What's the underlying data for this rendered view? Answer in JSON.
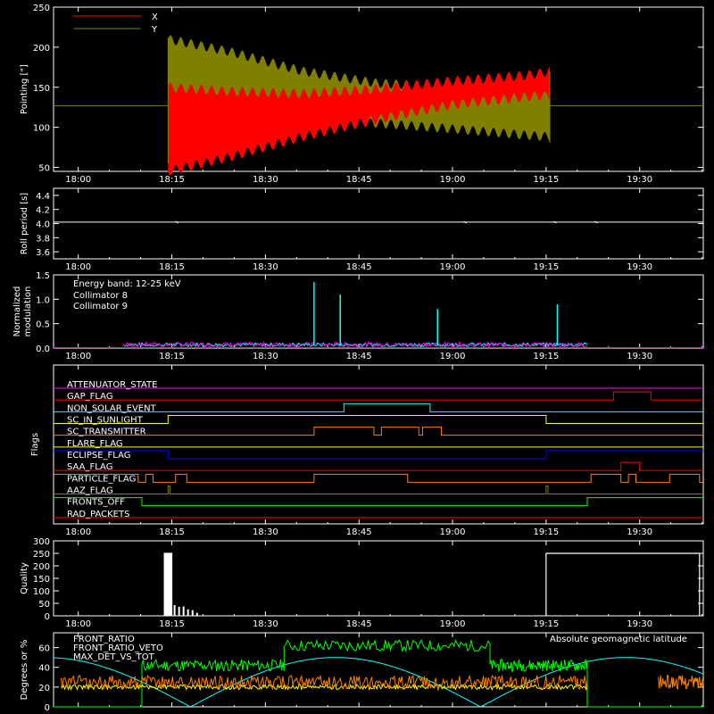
{
  "chart_data": [
    {
      "type": "area",
      "panel": "pointing",
      "ylabel": "Pointing [\"]",
      "yticks": [
        50,
        100,
        150,
        200,
        250
      ],
      "ylim": [
        45,
        250
      ],
      "xticks": [
        "18:00",
        "18:15",
        "18:30",
        "18:45",
        "19:00",
        "19:15",
        "19:30"
      ],
      "legend": [
        {
          "name": "X",
          "color": "#ff0000"
        },
        {
          "name": "Y",
          "color": "#808000"
        }
      ],
      "baseline": 127,
      "series": [
        {
          "name": "X",
          "color": "#ff0000",
          "t_min": [
            18.24,
            18.4,
            18.6,
            18.8,
            19.0,
            19.2,
            19.26
          ],
          "low": [
            45,
            62,
            88,
            110,
            128,
            138,
            140
          ],
          "high": [
            150,
            145,
            142,
            148,
            158,
            165,
            170
          ]
        },
        {
          "name": "Y",
          "color": "#808000",
          "t_min": [
            18.24,
            18.4,
            18.6,
            18.8,
            19.0,
            19.2,
            19.26
          ],
          "low": [
            95,
            105,
            110,
            105,
            98,
            90,
            88
          ],
          "high": [
            210,
            195,
            170,
            155,
            150,
            150,
            150
          ]
        }
      ]
    },
    {
      "type": "line",
      "panel": "roll",
      "ylabel": "Roll period [s]",
      "yticks": [
        "3.6",
        "3.8",
        "4.0",
        "4.2",
        "4.4"
      ],
      "ylim": [
        3.5,
        4.5
      ],
      "xticks": [
        "18:00",
        "18:15",
        "18:30",
        "18:45",
        "19:00",
        "19:15",
        "19:30"
      ],
      "series": [
        {
          "name": "",
          "color": "#ffffff",
          "value": 4.02
        }
      ]
    },
    {
      "type": "line",
      "panel": "modulation",
      "ylabel": "Normalized modulation",
      "yticks": [
        "0.0",
        "0.5",
        "1.0",
        "1.5"
      ],
      "ylim": [
        0,
        1.5
      ],
      "xticks": [
        "18:00",
        "18:15",
        "18:30",
        "18:45",
        "19:00",
        "19:15",
        "19:30"
      ],
      "legend_title": "Energy band: 12-25 keV",
      "legend": [
        {
          "name": "Collimator 8",
          "color": "#00ffff"
        },
        {
          "name": "Collimator 9",
          "color": "#ff00ff"
        }
      ],
      "spikes_c8": [
        {
          "t": 18.63,
          "v": 1.35
        },
        {
          "t": 18.7,
          "v": 1.1
        },
        {
          "t": 18.96,
          "v": 0.8
        },
        {
          "t": 19.28,
          "v": 0.9
        }
      ],
      "range": [
        18.12,
        19.36
      ],
      "baseline_value": 0.07
    },
    {
      "type": "table",
      "panel": "flags",
      "ylabel": "Flags",
      "xticks": [
        "18:00",
        "18:15",
        "18:30",
        "18:45",
        "19:00",
        "19:15",
        "19:30"
      ],
      "flags": [
        {
          "name": "ATTENUATOR_STATE",
          "color": "#ff00ff",
          "steps": [
            [
              18.0,
              0
            ],
            [
              19.67,
              0
            ]
          ]
        },
        {
          "name": "GAP_FLAG",
          "color": "#ff0000",
          "steps": [
            [
              18.0,
              0
            ],
            [
              19.43,
              1
            ],
            [
              19.53,
              0
            ],
            [
              19.67,
              0
            ]
          ]
        },
        {
          "name": "NON_SOLAR_EVENT",
          "color": "#00ffff",
          "steps": [
            [
              18.0,
              0
            ],
            [
              18.71,
              1
            ],
            [
              18.94,
              0
            ],
            [
              19.67,
              0
            ]
          ]
        },
        {
          "name": "SC_IN_SUNLIGHT",
          "color": "#ffff00",
          "steps": [
            [
              18.0,
              0
            ],
            [
              18.24,
              1
            ],
            [
              19.25,
              0
            ],
            [
              19.67,
              0
            ]
          ]
        },
        {
          "name": "SC_TRANSMITTER",
          "color": "#ff8000",
          "steps": [
            [
              18.0,
              0
            ],
            [
              18.63,
              1
            ],
            [
              18.79,
              0
            ],
            [
              18.81,
              1
            ],
            [
              18.91,
              0
            ],
            [
              18.92,
              1
            ],
            [
              18.97,
              0
            ],
            [
              19.67,
              0
            ]
          ]
        },
        {
          "name": "FLARE_FLAG",
          "color": "#ffff00",
          "steps": [
            [
              18.0,
              0
            ],
            [
              19.67,
              0
            ]
          ]
        },
        {
          "name": "ECLIPSE_FLAG",
          "color": "#0000ff",
          "steps": [
            [
              18.0,
              1
            ],
            [
              18.24,
              0
            ],
            [
              19.25,
              1
            ],
            [
              19.67,
              1
            ]
          ]
        },
        {
          "name": "SAA_FLAG",
          "color": "#ff0000",
          "steps": [
            [
              18.0,
              0
            ],
            [
              19.45,
              1
            ],
            [
              19.5,
              0
            ],
            [
              19.67,
              0
            ]
          ]
        },
        {
          "name": "PARTICLE_FLAG",
          "color": "#ff8000",
          "steps": [
            [
              18.0,
              1
            ],
            [
              18.16,
              0
            ],
            [
              18.18,
              1
            ],
            [
              18.2,
              0
            ],
            [
              18.26,
              1
            ],
            [
              18.29,
              0
            ],
            [
              18.63,
              1
            ],
            [
              18.88,
              0
            ],
            [
              19.37,
              1
            ],
            [
              19.45,
              0
            ],
            [
              19.47,
              1
            ],
            [
              19.49,
              0
            ],
            [
              19.58,
              1
            ],
            [
              19.66,
              0
            ],
            [
              19.67,
              0
            ]
          ]
        },
        {
          "name": "AAZ_FLAG",
          "color": "#808000",
          "steps": [
            [
              18.0,
              0
            ],
            [
              18.24,
              1
            ],
            [
              18.245,
              0
            ],
            [
              19.25,
              1
            ],
            [
              19.255,
              0
            ],
            [
              19.67,
              0
            ]
          ]
        },
        {
          "name": "FRONTS_OFF",
          "color": "#00ff00",
          "steps": [
            [
              18.0,
              1
            ],
            [
              18.17,
              0
            ],
            [
              19.36,
              1
            ],
            [
              19.67,
              1
            ]
          ]
        },
        {
          "name": "RAD_PACKETS",
          "color": "#ff0000",
          "steps": [
            [
              18.0,
              0
            ],
            [
              19.67,
              0
            ]
          ]
        }
      ]
    },
    {
      "type": "bar",
      "panel": "quality",
      "ylabel": "Quality",
      "yticks": [
        0,
        50,
        100,
        150,
        200,
        250,
        300
      ],
      "ylim": [
        0,
        300
      ],
      "xticks": [
        "18:00",
        "18:15",
        "18:30",
        "18:45",
        "19:00",
        "19:15",
        "19:30"
      ],
      "blocks": [
        {
          "t0": 18.23,
          "t1": 18.25,
          "v": 250
        },
        {
          "t0": 19.25,
          "t1": 19.66,
          "v": 250
        }
      ]
    },
    {
      "type": "line",
      "panel": "ratios",
      "ylabel": "Degrees or %",
      "yticks": [
        0,
        20,
        40,
        60
      ],
      "ylim": [
        0,
        75
      ],
      "legend": [
        {
          "name": "FRONT_RATIO",
          "color": "#ffff00"
        },
        {
          "name": "FRONT_RATIO_VETO",
          "color": "#00ff00"
        },
        {
          "name": "MAX_DET_VS_TOT",
          "color": "#ff8000"
        }
      ],
      "annotation": {
        "text": "Absolute geomagnetic latitude",
        "color": "#00ffff"
      },
      "green_segments": [
        {
          "t0": 18.17,
          "t1": 18.55,
          "v": 42
        },
        {
          "t0": 18.55,
          "t1": 19.1,
          "v": 62
        },
        {
          "t0": 19.1,
          "t1": 19.36,
          "v": 42
        }
      ],
      "geomag": {
        "amplitude": 50,
        "period_hours": 1.55,
        "phase": 18.3
      },
      "orange_level": 25
    }
  ],
  "colors": {
    "background": "#000000",
    "axes": "#ffffff"
  }
}
